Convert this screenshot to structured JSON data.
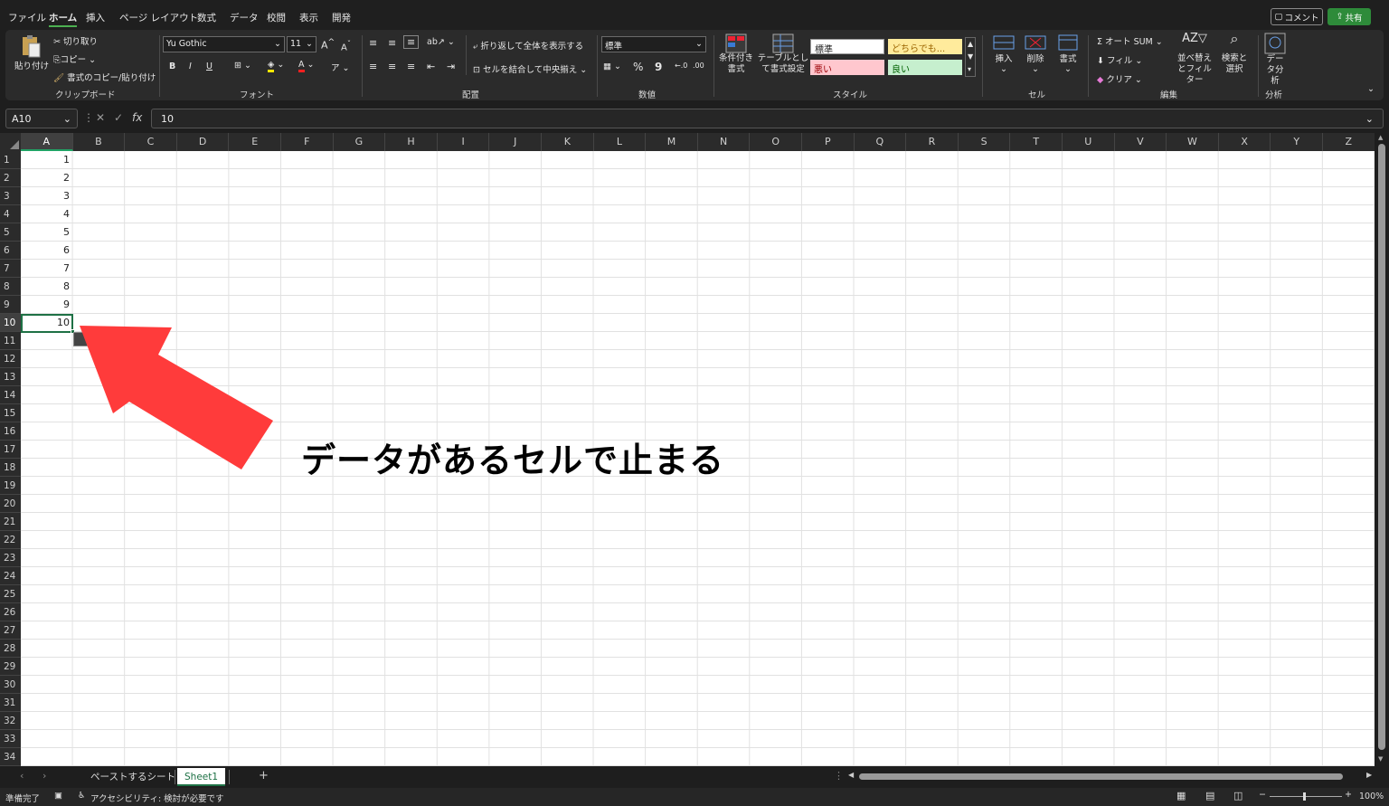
{
  "menu": {
    "tabs": [
      "ファイル",
      "ホーム",
      "挿入",
      "ページ レイアウト",
      "数式",
      "データ",
      "校閲",
      "表示",
      "開発"
    ],
    "active": "ホーム",
    "comment": "コメント",
    "share": "共有"
  },
  "ribbon": {
    "clipboard": {
      "paste": "貼り付け",
      "cut": "切り取り",
      "copy": "コピー",
      "format_painter": "書式のコピー/貼り付け",
      "label": "クリップボード"
    },
    "font": {
      "name": "Yu Gothic",
      "size": "11",
      "bold": "B",
      "italic": "I",
      "underline": "U",
      "label": "フォント"
    },
    "alignment": {
      "wrap": "折り返して全体を表示する",
      "merge": "セルを結合して中央揃え",
      "label": "配置"
    },
    "number": {
      "format": "標準",
      "percent": "%",
      "comma": "9",
      "label": "数値"
    },
    "styles": {
      "conditional": "条件付き書式",
      "table": "テーブルとして書式設定",
      "normal": "標準",
      "neutral": "どちらでも...",
      "bad": "悪い",
      "good": "良い",
      "label": "スタイル"
    },
    "cells": {
      "insert": "挿入",
      "delete": "削除",
      "format": "書式",
      "label": "セル"
    },
    "editing": {
      "autosum": "オート SUM",
      "fill": "フィル",
      "clear": "クリア",
      "sort": "並べ替えとフィルター",
      "find": "検索と選択",
      "label": "編集"
    },
    "analysis": {
      "data": "データ分析",
      "label": "分析"
    }
  },
  "formula": {
    "namebox": "A10",
    "fx": "fx",
    "value": "10"
  },
  "columns": [
    "A",
    "B",
    "C",
    "D",
    "E",
    "F",
    "G",
    "H",
    "I",
    "J",
    "K",
    "L",
    "M",
    "N",
    "O",
    "P",
    "Q",
    "R",
    "S",
    "T",
    "U",
    "V",
    "W",
    "X",
    "Y",
    "Z"
  ],
  "rows": [
    "1",
    "2",
    "3",
    "4",
    "5",
    "6",
    "7",
    "8",
    "9",
    "10",
    "11",
    "12",
    "13",
    "14",
    "15",
    "16",
    "17",
    "18",
    "19",
    "20",
    "21",
    "22",
    "23",
    "24",
    "25",
    "26",
    "27",
    "28",
    "29",
    "30",
    "31",
    "32",
    "33",
    "34"
  ],
  "cells_A": [
    "1",
    "2",
    "3",
    "4",
    "5",
    "6",
    "7",
    "8",
    "9",
    "10"
  ],
  "annotation": {
    "text": "データがあるセルで止まる",
    "arrow_color": "#ff3b3b"
  },
  "sheets": {
    "tabs": [
      "ペーストするシート",
      "Sheet1"
    ],
    "active": "Sheet1",
    "add": "+"
  },
  "status": {
    "ready": "準備完了",
    "accessibility": "アクセシビリティ: 検討が必要です",
    "zoom": "100%"
  }
}
